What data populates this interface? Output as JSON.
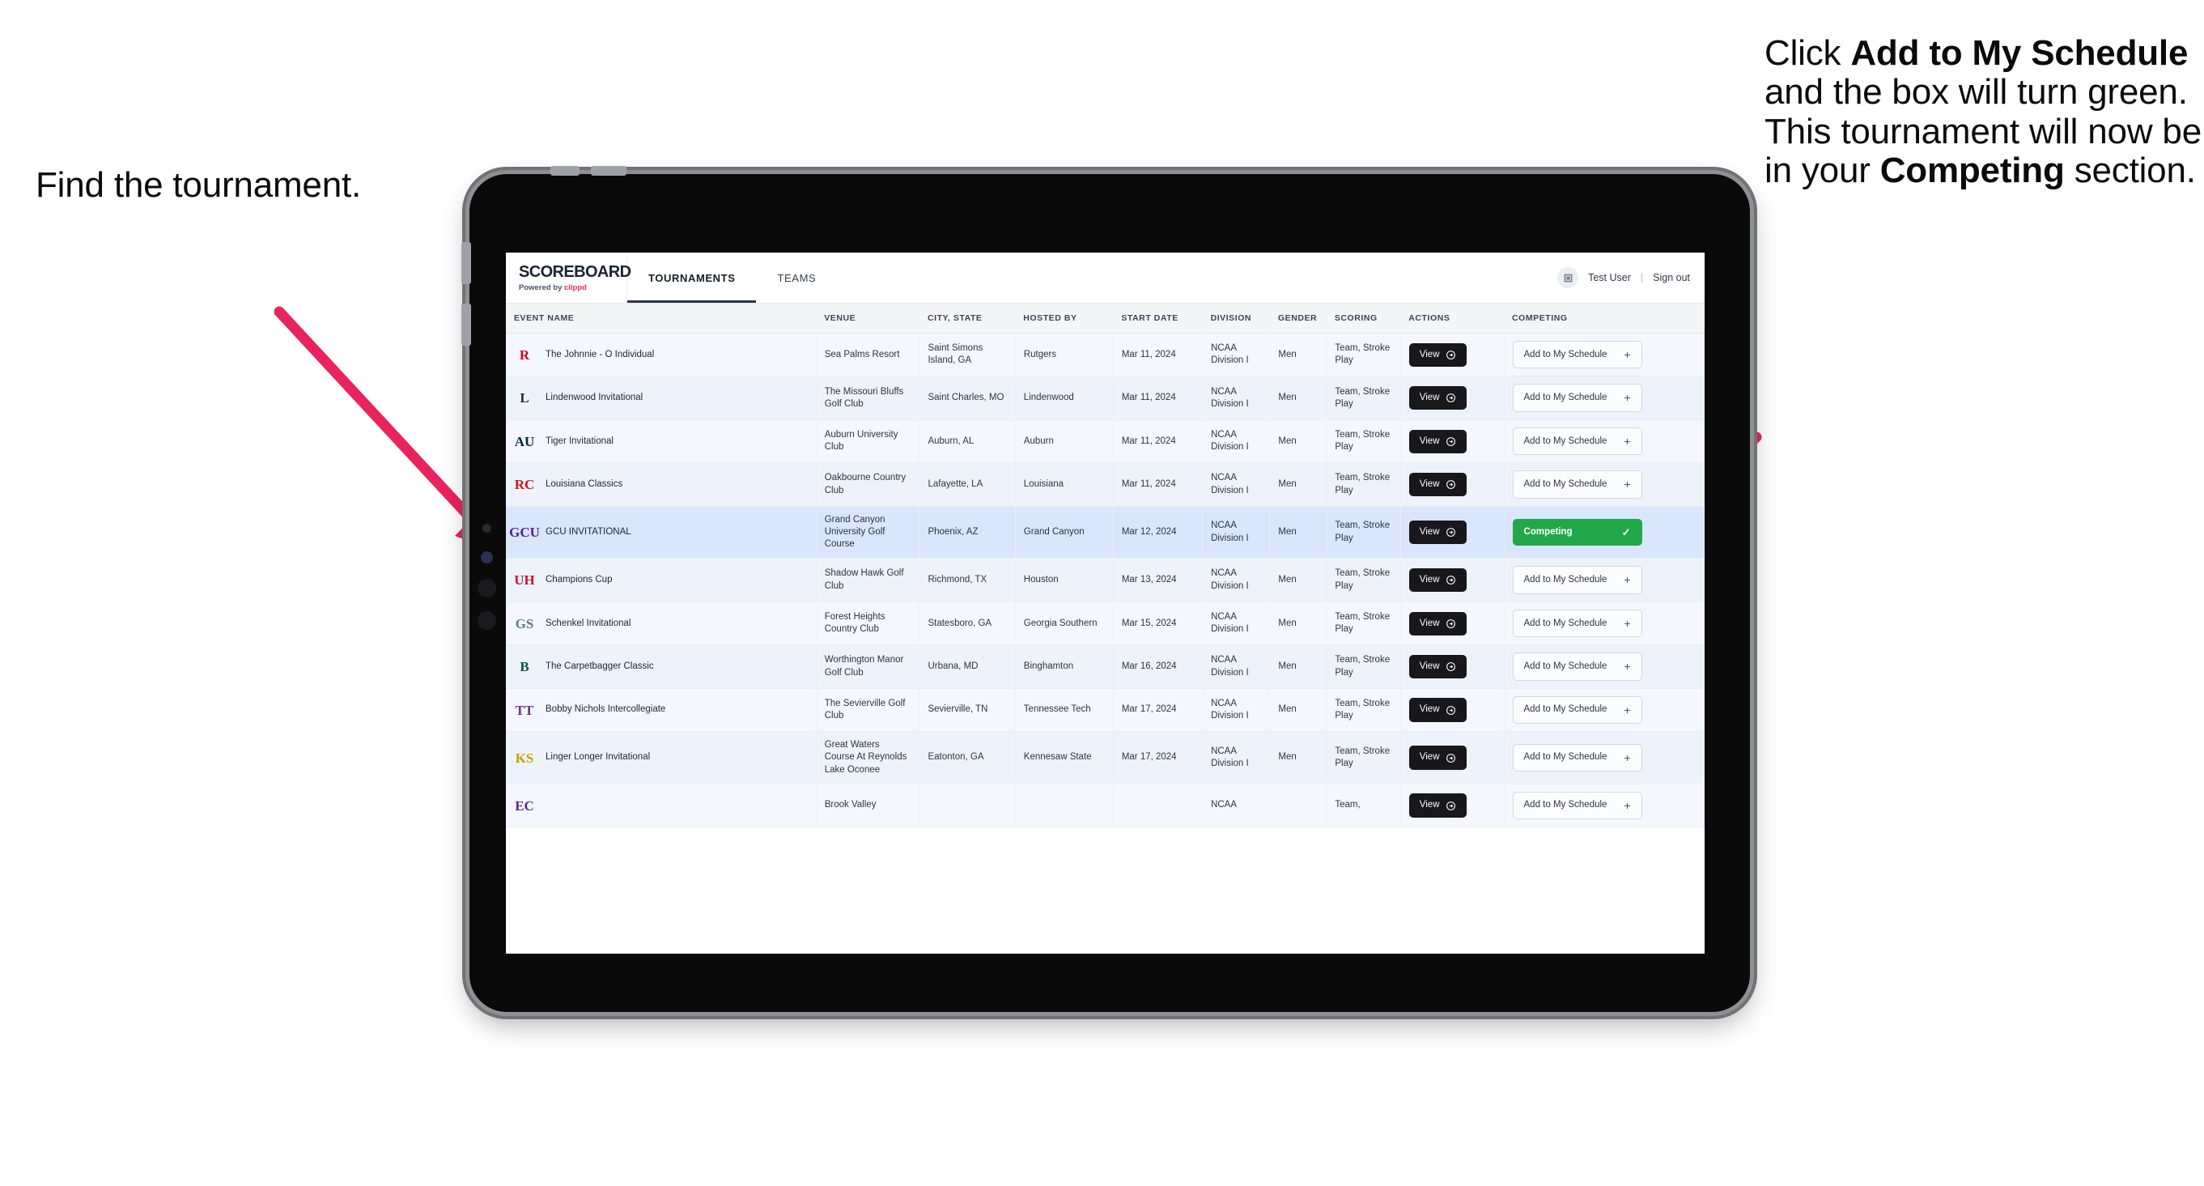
{
  "annotations": {
    "left": "Find the tournament.",
    "right_parts": [
      {
        "t": "Click ",
        "b": false
      },
      {
        "t": "Add to My Schedule",
        "b": true
      },
      {
        "t": " and the box will turn green. This tournament will now be in your ",
        "b": false
      },
      {
        "t": "Competing",
        "b": true
      },
      {
        "t": " section.",
        "b": false
      }
    ],
    "arrow_color": "#E8245F"
  },
  "app": {
    "brand": {
      "title": "SCOREBOARD",
      "powered_prefix": "Powered by ",
      "powered_brand": "clippd"
    },
    "nav": [
      {
        "label": "TOURNAMENTS",
        "active": true
      },
      {
        "label": "TEAMS",
        "active": false
      }
    ],
    "account": {
      "avatar_icon": "user-badge-icon",
      "user": "Test User",
      "separator": "|",
      "signout": "Sign out"
    },
    "table": {
      "columns": [
        "EVENT NAME",
        "VENUE",
        "CITY, STATE",
        "HOSTED BY",
        "START DATE",
        "DIVISION",
        "GENDER",
        "SCORING",
        "ACTIONS",
        "COMPETING"
      ],
      "view_label": "View",
      "add_label": "Add to My Schedule",
      "add_plus": "+",
      "competing_label": "Competing",
      "competing_check": "✓",
      "competing_color": "#22A84A",
      "rows": [
        {
          "logo": "R",
          "logo_color": "#CC0033",
          "event": "The Johnnie - O Individual",
          "venue": "Sea Palms Resort",
          "city": "Saint Simons Island, GA",
          "hosted": "Rutgers",
          "date": "Mar 11, 2024",
          "division": "NCAA Division I",
          "gender": "Men",
          "scoring": "Team, Stroke Play",
          "competing": false
        },
        {
          "logo": "L",
          "logo_color": "#2B2B28",
          "event": "Lindenwood Invitational",
          "venue": "The Missouri Bluffs Golf Club",
          "city": "Saint Charles, MO",
          "hosted": "Lindenwood",
          "date": "Mar 11, 2024",
          "division": "NCAA Division I",
          "gender": "Men",
          "scoring": "Team, Stroke Play",
          "competing": false
        },
        {
          "logo": "AU",
          "logo_color": "#0C2340",
          "event": "Tiger Invitational",
          "venue": "Auburn University Club",
          "city": "Auburn, AL",
          "hosted": "Auburn",
          "date": "Mar 11, 2024",
          "division": "NCAA Division I",
          "gender": "Men",
          "scoring": "Team, Stroke Play",
          "competing": false
        },
        {
          "logo": "RC",
          "logo_color": "#CE181E",
          "event": "Louisiana Classics",
          "venue": "Oakbourne Country Club",
          "city": "Lafayette, LA",
          "hosted": "Louisiana",
          "date": "Mar 11, 2024",
          "division": "NCAA Division I",
          "gender": "Men",
          "scoring": "Team, Stroke Play",
          "competing": false
        },
        {
          "logo": "GCU",
          "logo_color": "#522398",
          "event": "GCU INVITATIONAL",
          "venue": "Grand Canyon University Golf Course",
          "city": "Phoenix, AZ",
          "hosted": "Grand Canyon",
          "date": "Mar 12, 2024",
          "division": "NCAA Division I",
          "gender": "Men",
          "scoring": "Team, Stroke Play",
          "competing": true
        },
        {
          "logo": "UH",
          "logo_color": "#C8102E",
          "event": "Champions Cup",
          "venue": "Shadow Hawk Golf Club",
          "city": "Richmond, TX",
          "hosted": "Houston",
          "date": "Mar 13, 2024",
          "division": "NCAA Division I",
          "gender": "Men",
          "scoring": "Team, Stroke Play",
          "competing": false
        },
        {
          "logo": "GS",
          "logo_color": "#5C7C94",
          "event": "Schenkel Invitational",
          "venue": "Forest Heights Country Club",
          "city": "Statesboro, GA",
          "hosted": "Georgia Southern",
          "date": "Mar 15, 2024",
          "division": "NCAA Division I",
          "gender": "Men",
          "scoring": "Team, Stroke Play",
          "competing": false
        },
        {
          "logo": "B",
          "logo_color": "#0C5449",
          "event": "The Carpetbagger Classic",
          "venue": "Worthington Manor Golf Club",
          "city": "Urbana, MD",
          "hosted": "Binghamton",
          "date": "Mar 16, 2024",
          "division": "NCAA Division I",
          "gender": "Men",
          "scoring": "Team, Stroke Play",
          "competing": false
        },
        {
          "logo": "TT",
          "logo_color": "#702F8A",
          "event": "Bobby Nichols Intercollegiate",
          "venue": "The Sevierville Golf Club",
          "city": "Sevierville, TN",
          "hosted": "Tennessee Tech",
          "date": "Mar 17, 2024",
          "division": "NCAA Division I",
          "gender": "Men",
          "scoring": "Team, Stroke Play",
          "competing": false
        },
        {
          "logo": "KS",
          "logo_color": "#C6A00A",
          "event": "Linger Longer Invitational",
          "venue": "Great Waters Course At Reynolds Lake Oconee",
          "city": "Eatonton, GA",
          "hosted": "Kennesaw State",
          "date": "Mar 17, 2024",
          "division": "NCAA Division I",
          "gender": "Men",
          "scoring": "Team, Stroke Play",
          "competing": false
        },
        {
          "logo": "EC",
          "logo_color": "#592A8A",
          "event": "",
          "venue": "Brook Valley",
          "city": "",
          "hosted": "",
          "date": "",
          "division": "NCAA",
          "gender": "",
          "scoring": "Team,",
          "competing": false
        }
      ]
    }
  }
}
